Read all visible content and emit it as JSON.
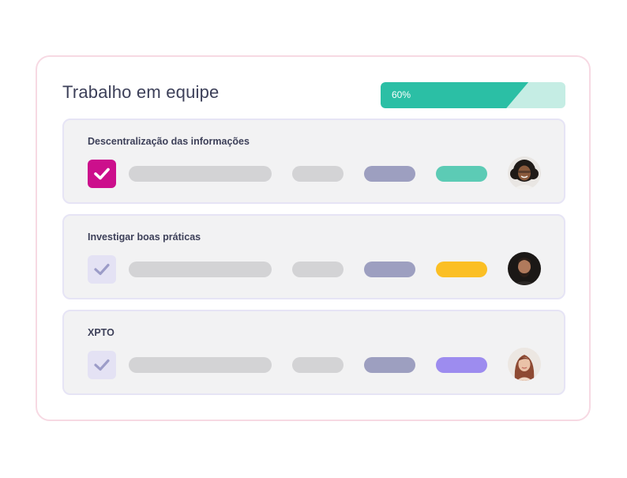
{
  "header": {
    "title": "Trabalho em equipe",
    "progress_label": "60%",
    "progress_value": 0.6
  },
  "colors": {
    "progress_fill": "#2bbfa5",
    "progress_track": "#c5ede4",
    "check_active": "#cc0f8c",
    "check_inactive": "#e4e2f4"
  },
  "tasks": [
    {
      "title": "Descentralização das informações",
      "checked": true,
      "status_color": "#5ccbb5",
      "avatar": "woman-curly-hair-avatar"
    },
    {
      "title": "Investigar boas práticas",
      "checked": false,
      "status_color": "#fbbf24",
      "avatar": "man-beard-avatar"
    },
    {
      "title": "XPTO",
      "checked": false,
      "status_color": "#9d8cef",
      "avatar": "woman-long-hair-avatar"
    }
  ]
}
